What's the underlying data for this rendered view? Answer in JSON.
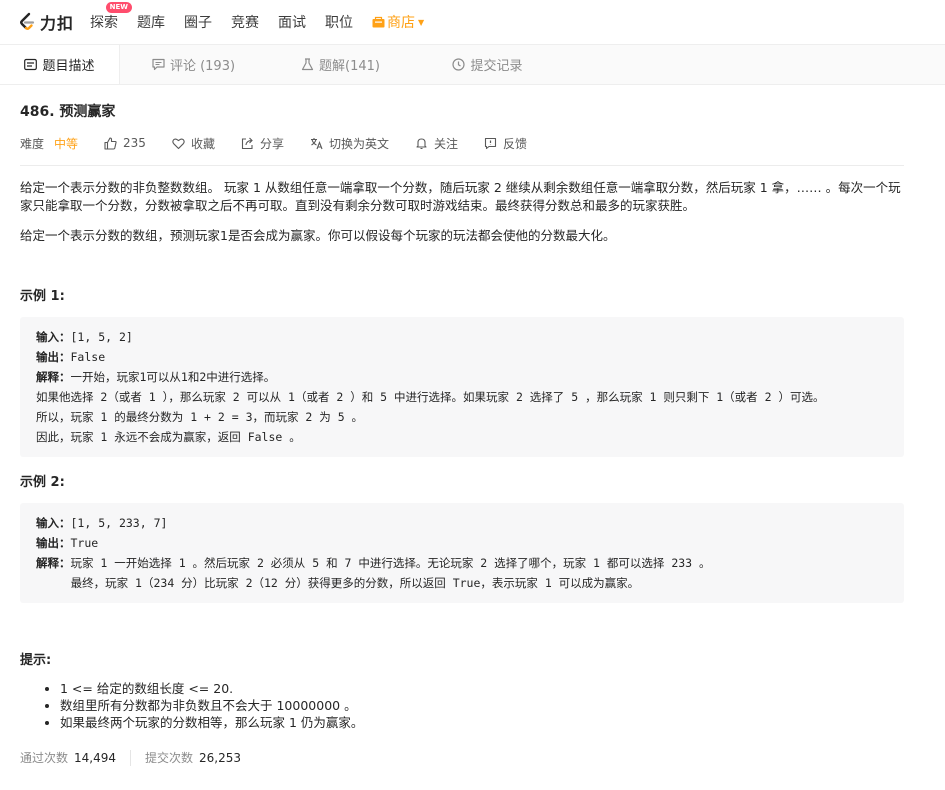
{
  "nav": {
    "logo_text": "力扣",
    "items": [
      "探索",
      "题库",
      "圈子",
      "竞赛",
      "面试",
      "职位"
    ],
    "badge": "NEW",
    "store": "商店"
  },
  "tabs": [
    {
      "label": "题目描述"
    },
    {
      "label": "评论 (193)"
    },
    {
      "label": "题解(141)"
    },
    {
      "label": "提交记录"
    }
  ],
  "problem": {
    "title": "486. 预测赢家",
    "difficulty_label": "难度",
    "difficulty": "中等",
    "likes": "235",
    "actions": [
      "收藏",
      "分享",
      "切换为英文",
      "关注",
      "反馈"
    ],
    "description_1": "给定一个表示分数的非负整数数组。 玩家 1 从数组任意一端拿取一个分数，随后玩家 2 继续从剩余数组任意一端拿取分数，然后玩家 1 拿，…… 。每次一个玩家只能拿取一个分数，分数被拿取之后不再可取。直到没有剩余分数可取时游戏结束。最终获得分数总和最多的玩家获胜。",
    "description_2": "给定一个表示分数的数组，预测玩家1是否会成为赢家。你可以假设每个玩家的玩法都会使他的分数最大化。",
    "example1_title": "示例 1:",
    "example1": {
      "input_label": "输入：",
      "input": "[1, 5, 2]",
      "output_label": "输出：",
      "output": "False",
      "explain_label": "解释：",
      "explain_lines": [
        "一开始，玩家1可以从1和2中进行选择。",
        "如果他选择 2（或者 1 ），那么玩家 2 可以从 1（或者 2 ）和 5 中进行选择。如果玩家 2 选择了 5 ，那么玩家 1 则只剩下 1（或者 2 ）可选。",
        "所以，玩家 1 的最终分数为 1 + 2 = 3，而玩家 2 为 5 。",
        "因此，玩家 1 永远不会成为赢家，返回 False 。"
      ]
    },
    "example2_title": "示例 2:",
    "example2": {
      "input_label": "输入：",
      "input": "[1, 5, 233, 7]",
      "output_label": "输出：",
      "output": "True",
      "explain_label": "解释：",
      "explain_lines": [
        "玩家 1 一开始选择 1 。然后玩家 2 必须从 5 和 7 中进行选择。无论玩家 2 选择了哪个，玩家 1 都可以选择 233 。",
        "     最终，玩家 1（234 分）比玩家 2（12 分）获得更多的分数，所以返回 True，表示玩家 1 可以成为赢家。"
      ]
    },
    "hint_title": "提示:",
    "hints": [
      "1 <= 给定的数组长度 <= 20.",
      "数组里所有分数都为非负数且不会大于 10000000 。",
      "如果最终两个玩家的分数相等，那么玩家 1 仍为赢家。"
    ],
    "stats": {
      "accepted_label": "通过次数",
      "accepted": "14,494",
      "submissions_label": "提交次数",
      "submissions": "26,253"
    }
  },
  "colors": {
    "accent": "#ffa116",
    "badge": "#ff4d6d"
  }
}
